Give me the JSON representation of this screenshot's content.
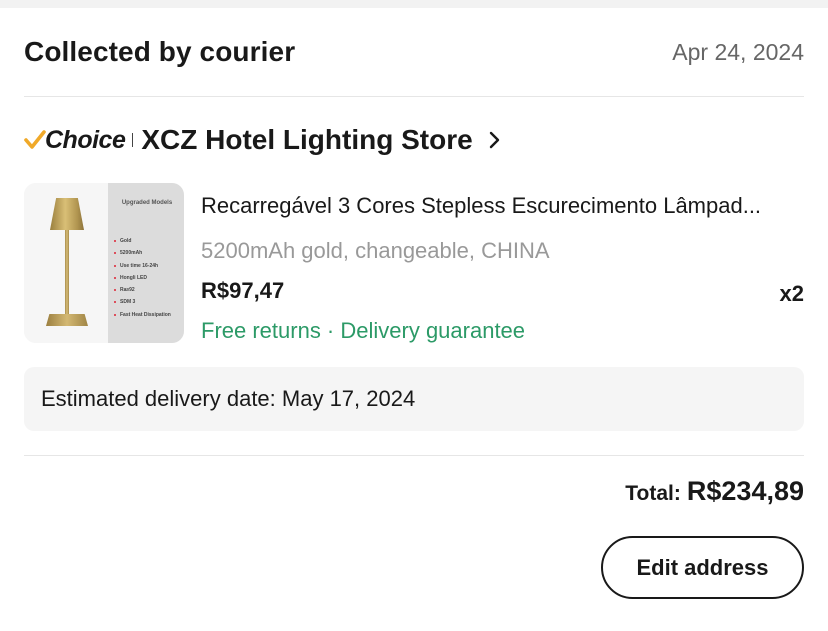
{
  "order": {
    "status": "Collected by courier",
    "date": "Apr 24, 2024"
  },
  "store": {
    "badge": "Choice",
    "name": "XCZ Hotel Lighting Store",
    "accent_color": "#f0a929"
  },
  "product": {
    "title": "Recarregável 3 Cores Stepless Escurecimento Lâmpad...",
    "variant": "5200mAh gold, changeable, CHINA",
    "price": "R$97,47",
    "quantity": "x2",
    "benefits": "Free returns · Delivery guarantee",
    "benefits_color": "#2c9a67",
    "thumbnail": {
      "heading": "Upgraded Models",
      "features": [
        "Gold",
        "5200mAh",
        "Use time 16-24h",
        "Hongli LED",
        "Ra≥92",
        "SDM 3",
        "Fast Heat Dissipation"
      ]
    }
  },
  "delivery": {
    "estimate": "Estimated delivery date: May 17, 2024"
  },
  "summary": {
    "total_label": "Total:",
    "total_value": "R$234,89"
  },
  "actions": {
    "edit_address_label": "Edit address"
  }
}
